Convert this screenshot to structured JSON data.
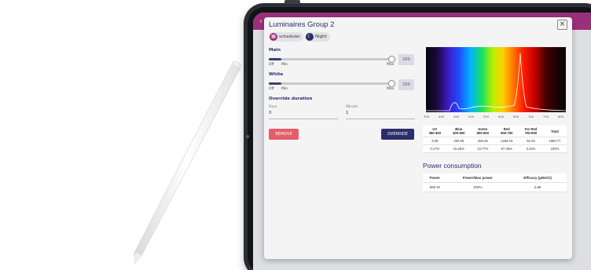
{
  "dialog": {
    "title": "Luminaires Group 2",
    "close_icon": "×",
    "chips": [
      {
        "label": "scheduler",
        "icon": "calendar-icon"
      },
      {
        "label": "Night",
        "icon": "moon-icon"
      }
    ]
  },
  "main": {
    "label": "Main",
    "value": "200",
    "level_fraction": 1.0,
    "min_left": "Off",
    "min_right": "Min",
    "max": "Max"
  },
  "white": {
    "label": "White",
    "value": "200",
    "level_fraction": 1.0,
    "min_left": "Off",
    "min_right": "Min",
    "max": "Max"
  },
  "override": {
    "label": "Override duration",
    "hour_label": "Hour",
    "hour_value": "0",
    "minute_label": "Minute",
    "minute_value": "1",
    "remove_label": "REMOVE",
    "override_label": "OVERRIDE"
  },
  "spectrum": {
    "ticks": [
      "350",
      "400",
      "450",
      "500",
      "550",
      "600",
      "650",
      "700",
      "750",
      "800"
    ]
  },
  "spectrum_table": {
    "headers": [
      [
        "UV",
        "350-400"
      ],
      [
        "Blue",
        "400-500"
      ],
      [
        "Green",
        "500-600"
      ],
      [
        "Red",
        "600-700"
      ],
      [
        "Far Red",
        "700-800"
      ],
      [
        "Total",
        ""
      ]
    ],
    "rows": [
      [
        "3.08",
        "283.99",
        "256.28",
        "1255.19",
        "62.25",
        "1860.77"
      ],
      [
        "0.17%",
        "15.26%",
        "13.77%",
        "67.46%",
        "3.34%",
        "100%"
      ]
    ]
  },
  "power": {
    "title": "Power consumption",
    "headers": [
      "Power",
      "Power/Max power",
      "Efficacy (µMol/J)"
    ],
    "row": [
      "650 W",
      "100%",
      "2.86"
    ]
  },
  "stylus": {
    "engraving": "Pencil"
  },
  "colors": {
    "accent": "#9c2f7c",
    "navy": "#2a2f6b",
    "remove": "#e45d6a"
  }
}
